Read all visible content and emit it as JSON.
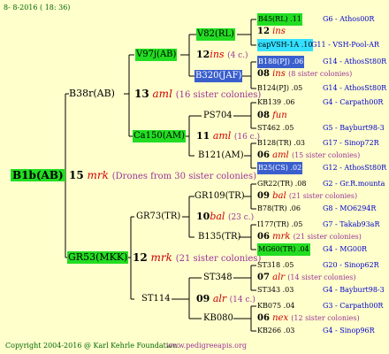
{
  "header": {
    "date": "8- 8-2016 ( 18: 36)"
  },
  "footer": {
    "copyright": "Copyright 2004-2016 @ Karl Kehrle Foundation.",
    "url": "www.pedigreeapis.org"
  },
  "colors": {
    "background": "#ffffcc",
    "highlight_green": "#22dd22",
    "highlight_blue": "#3a5fcd",
    "highlight_cyan": "#33e0ff",
    "line": "#000000"
  },
  "root": {
    "name": "B1b(AB)"
  },
  "gen1": [
    {
      "name": "B38r(AB)",
      "num": "13",
      "year": "aml",
      "note": "(16 sister colonies)"
    },
    {
      "name": "GR53(MKK)",
      "num": "12",
      "year": "mrk",
      "note": "(21 sister colonies)"
    }
  ],
  "root_drones": {
    "num": "15",
    "year": "mrk",
    "note": "(Drones from 30 sister colonies)"
  },
  "gen2": [
    {
      "name": "V97j(AB)",
      "num": "12",
      "year": "ins",
      "note": "(4 c.)"
    },
    {
      "name": "Ca150(AM)",
      "num": "11",
      "year": "aml",
      "note": "(16 c.)"
    },
    {
      "name": "GR73(TR)",
      "num": "10",
      "year": "bal",
      "note": "(23 c.)"
    },
    {
      "name": "ST114",
      "num": "09",
      "year": "alr",
      "note": "(14 c.)"
    }
  ],
  "gen3": [
    {
      "name": "V82(RL)"
    },
    {
      "name": "B320(JAF)"
    },
    {
      "name": "PS704"
    },
    {
      "name": "B121(AM)"
    },
    {
      "name": "GR109(TR)"
    },
    {
      "name": "B135(TR)"
    },
    {
      "name": "ST348"
    },
    {
      "name": "KB080"
    }
  ],
  "gen4": [
    {
      "text": "B45(RL) .11",
      "ref": "G6 - Athos00R"
    },
    {
      "num": "12",
      "year": "ins"
    },
    {
      "text": "capVSH-1A .10",
      "ref": "G11 - VSH-Pool-AR"
    },
    {
      "text": "B188(PJ) .06",
      "ref": "G14 - AthosSt80R"
    },
    {
      "num": "08",
      "year": "ins",
      "note": "(8 sister colonies)"
    },
    {
      "text": "B124(PJ) .05",
      "ref": "G14 - AthosSt80R"
    },
    {
      "text": "KB139 .06",
      "ref": "G4 - Carpath00R"
    },
    {
      "num": "08",
      "year": "fun"
    },
    {
      "text": "ST462 .05",
      "ref": "G5 - Bayburt98-3"
    },
    {
      "text": "B128(TR) .03",
      "ref": "G17 - Sinop72R"
    },
    {
      "num": "06",
      "year": "aml",
      "note": "(15 sister colonies)"
    },
    {
      "text": "B25(CS) .02",
      "ref": "G12 - AthosSt80R"
    },
    {
      "text": "GR22(TR) .08",
      "ref": "G2 - Gr.R.mounta"
    },
    {
      "num": "09",
      "year": "bal",
      "note": "(21 sister colonies)"
    },
    {
      "text": "B78(TR) .06",
      "ref": "G8 - MO6294R"
    },
    {
      "text": "I177(TR) .05",
      "ref": "G7 - Takab93aR"
    },
    {
      "num": "06",
      "year": "mrk",
      "note": "(21 sister colonies)"
    },
    {
      "text": "MG60(TR) .04",
      "ref": "G4 - MG00R"
    },
    {
      "text": "ST318 .05",
      "ref": "G20 - Sinop62R"
    },
    {
      "num": "07",
      "year": "alr",
      "note": "(14 sister colonies)"
    },
    {
      "text": "ST343 .03",
      "ref": "G4 - Bayburt98-3"
    },
    {
      "text": "KB075 .04",
      "ref": "G3 - Carpath00R"
    },
    {
      "num": "06",
      "year": "nex",
      "note": "(12 sister colonies)"
    },
    {
      "text": "KB266 .03",
      "ref": "G4 - Sinop96R"
    }
  ]
}
